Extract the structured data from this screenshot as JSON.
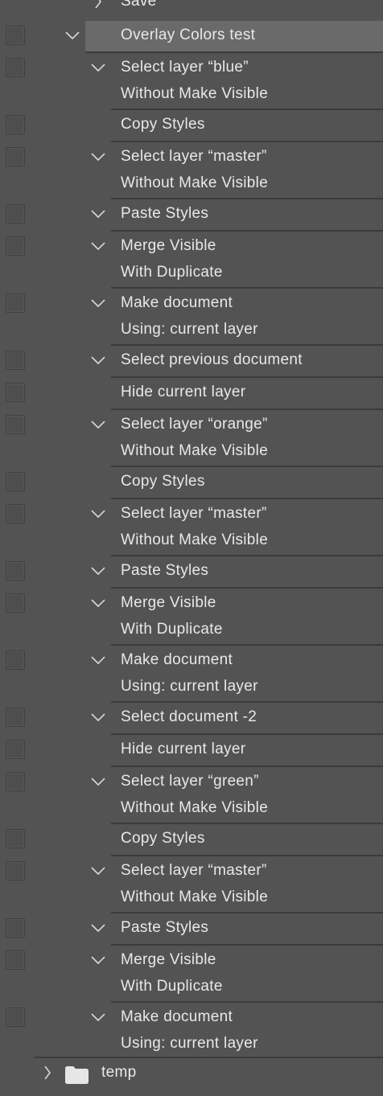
{
  "actions_panel": {
    "set_above": {
      "label": "Save"
    },
    "action": {
      "label": "Overlay Colors test"
    },
    "steps": [
      {
        "label": "Select layer “blue”",
        "expanded": true,
        "detail": "Without Make Visible"
      },
      {
        "label": "Copy Styles",
        "expanded": false,
        "detail": ""
      },
      {
        "label": "Select layer “master”",
        "expanded": true,
        "detail": "Without Make Visible"
      },
      {
        "label": "Paste Styles",
        "expanded": true,
        "detail": ""
      },
      {
        "label": "Merge Visible",
        "expanded": true,
        "detail": "With Duplicate"
      },
      {
        "label": "Make document",
        "expanded": true,
        "detail": "Using: current layer"
      },
      {
        "label": "Select previous document",
        "expanded": true,
        "detail": ""
      },
      {
        "label": "Hide current layer",
        "expanded": false,
        "detail": ""
      },
      {
        "label": "Select layer “orange”",
        "expanded": true,
        "detail": "Without Make Visible"
      },
      {
        "label": "Copy Styles",
        "expanded": false,
        "detail": ""
      },
      {
        "label": "Select layer “master”",
        "expanded": true,
        "detail": "Without Make Visible"
      },
      {
        "label": "Paste Styles",
        "expanded": true,
        "detail": ""
      },
      {
        "label": "Merge Visible",
        "expanded": true,
        "detail": "With Duplicate"
      },
      {
        "label": "Make document",
        "expanded": true,
        "detail": "Using: current layer"
      },
      {
        "label": "Select document -2",
        "expanded": true,
        "detail": ""
      },
      {
        "label": "Hide current layer",
        "expanded": false,
        "detail": ""
      },
      {
        "label": "Select layer “green”",
        "expanded": true,
        "detail": "Without Make Visible"
      },
      {
        "label": "Copy Styles",
        "expanded": false,
        "detail": ""
      },
      {
        "label": "Select layer “master”",
        "expanded": true,
        "detail": "Without Make Visible"
      },
      {
        "label": "Paste Styles",
        "expanded": true,
        "detail": ""
      },
      {
        "label": "Merge Visible",
        "expanded": true,
        "detail": "With Duplicate"
      },
      {
        "label": "Make document",
        "expanded": true,
        "detail": "Using: current layer"
      }
    ],
    "next_set": {
      "label": "temp",
      "icon": "folder-icon"
    }
  },
  "colors": {
    "panel_bg": "#535353",
    "selected_row": "#6a6a6a",
    "divider": "#3b3b3b",
    "text": "#e8e8e8"
  }
}
